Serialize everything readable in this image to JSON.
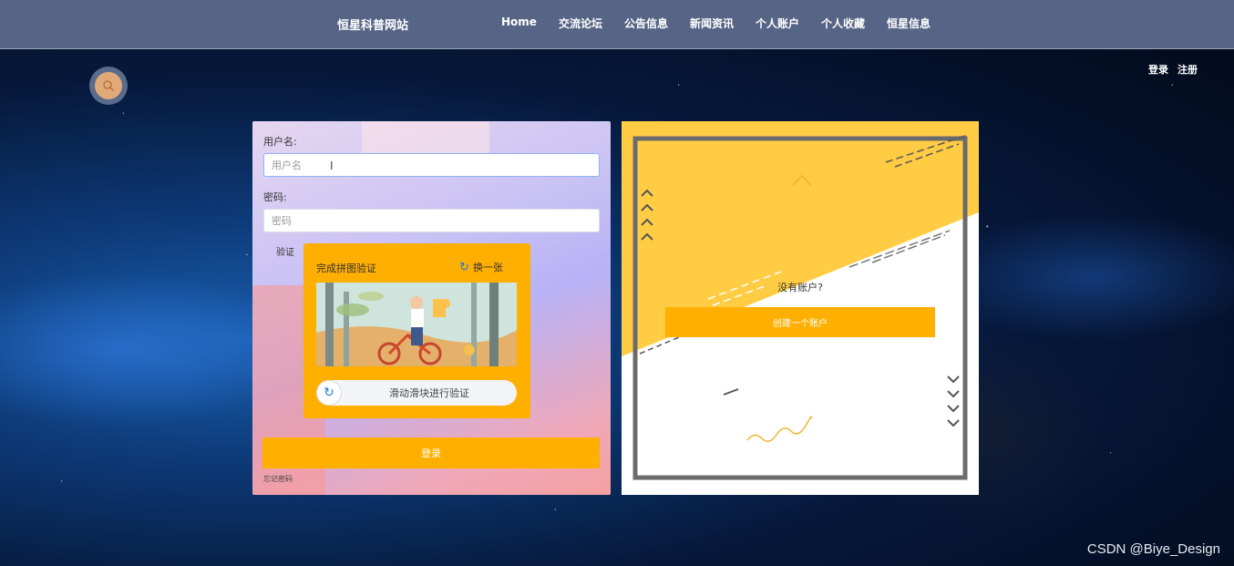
{
  "nav": {
    "brand": "恒星科普网站",
    "items": [
      "Home",
      "交流论坛",
      "公告信息",
      "新闻资讯",
      "个人账户",
      "个人收藏",
      "恒星信息"
    ]
  },
  "auth": {
    "login": "登录",
    "register": "注册"
  },
  "login_form": {
    "username_label": "用户名:",
    "username_placeholder": "用户名",
    "password_label": "密码:",
    "password_placeholder": "密码",
    "verify_label": "验证",
    "captcha_title": "完成拼图验证",
    "captcha_refresh": "换一张",
    "slider_text": "滑动滑块进行验证",
    "submit": "登录",
    "forgot": "忘记密码"
  },
  "signup_panel": {
    "prompt": "没有账户?",
    "create": "创建一个账户"
  },
  "watermark": "CSDN @Biye_Design",
  "colors": {
    "accent": "#ffaf00",
    "topbar": "#566585",
    "panel_yellow": "#ffcc44"
  }
}
